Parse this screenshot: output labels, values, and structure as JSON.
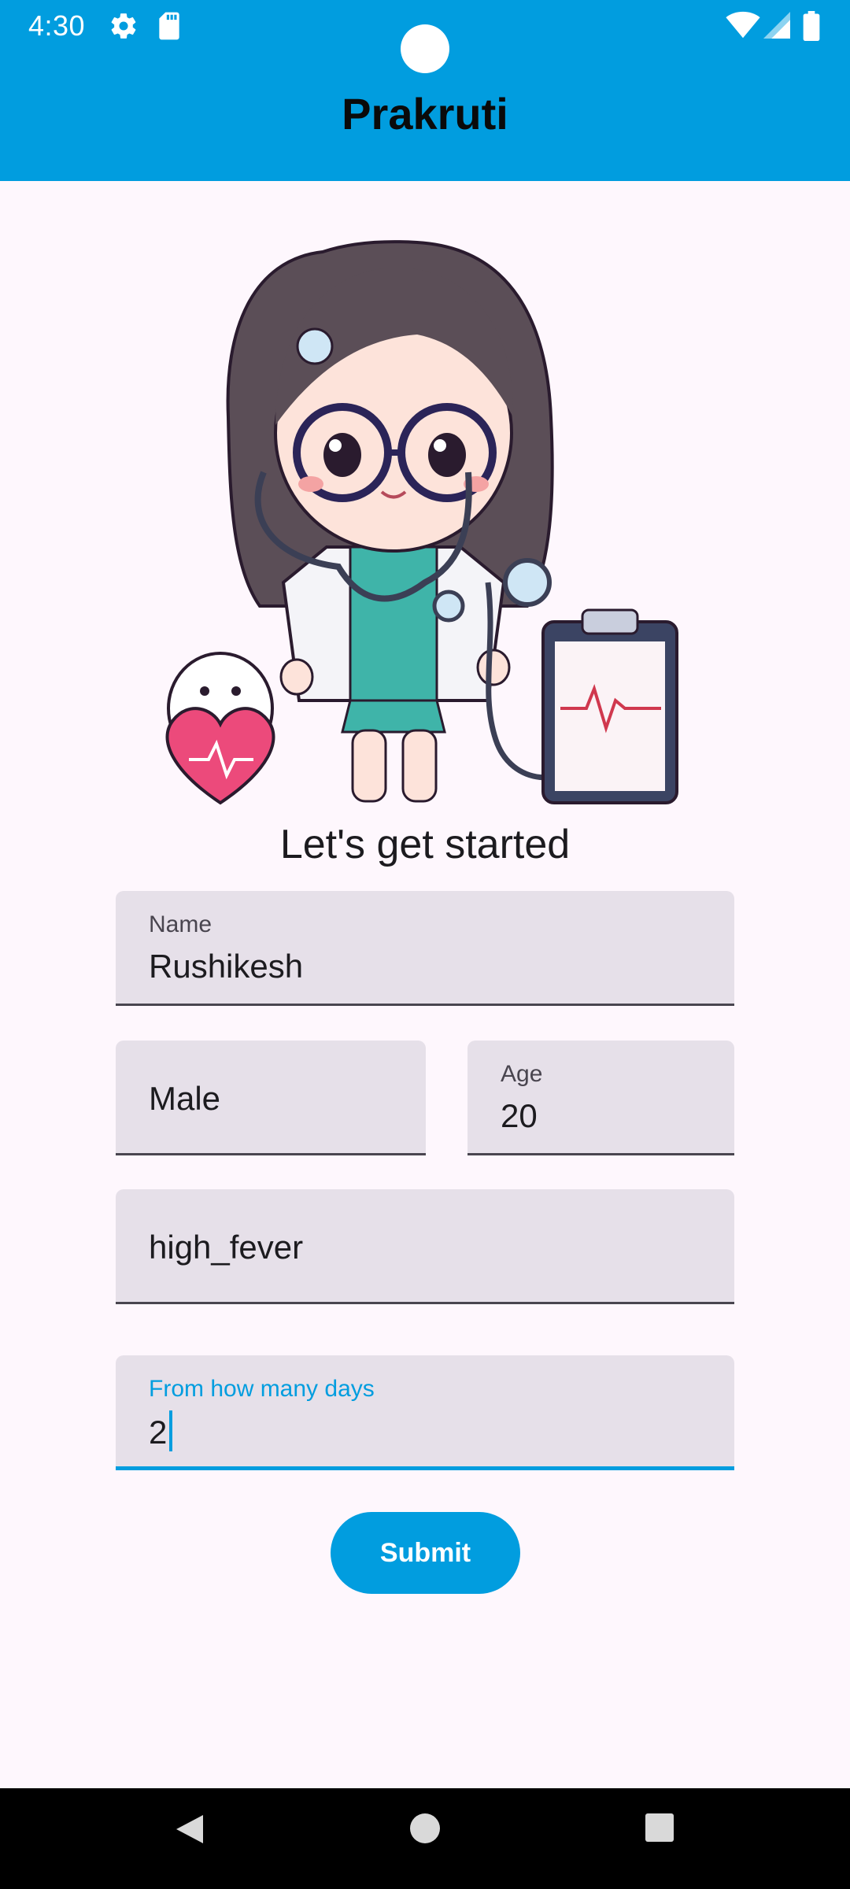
{
  "status_bar": {
    "time": "4:30",
    "icons": [
      "settings-icon",
      "sd-card-icon",
      "wifi-icon",
      "cell-signal-icon",
      "battery-icon"
    ]
  },
  "app_bar": {
    "title": "Prakruti",
    "color": "#019ddf"
  },
  "illustration": {
    "icon": "doctor-illustration"
  },
  "form": {
    "headline": "Let's get started",
    "name": {
      "label": "Name",
      "value": "Rushikesh"
    },
    "gender": {
      "value": "Male"
    },
    "age": {
      "label": "Age",
      "value": "20"
    },
    "symptom": {
      "value": "high_fever"
    },
    "days": {
      "label": "From how many days",
      "value": "2"
    },
    "submit_label": "Submit"
  },
  "nav_bar": {
    "buttons": [
      "back-icon",
      "home-icon",
      "recents-icon"
    ]
  }
}
